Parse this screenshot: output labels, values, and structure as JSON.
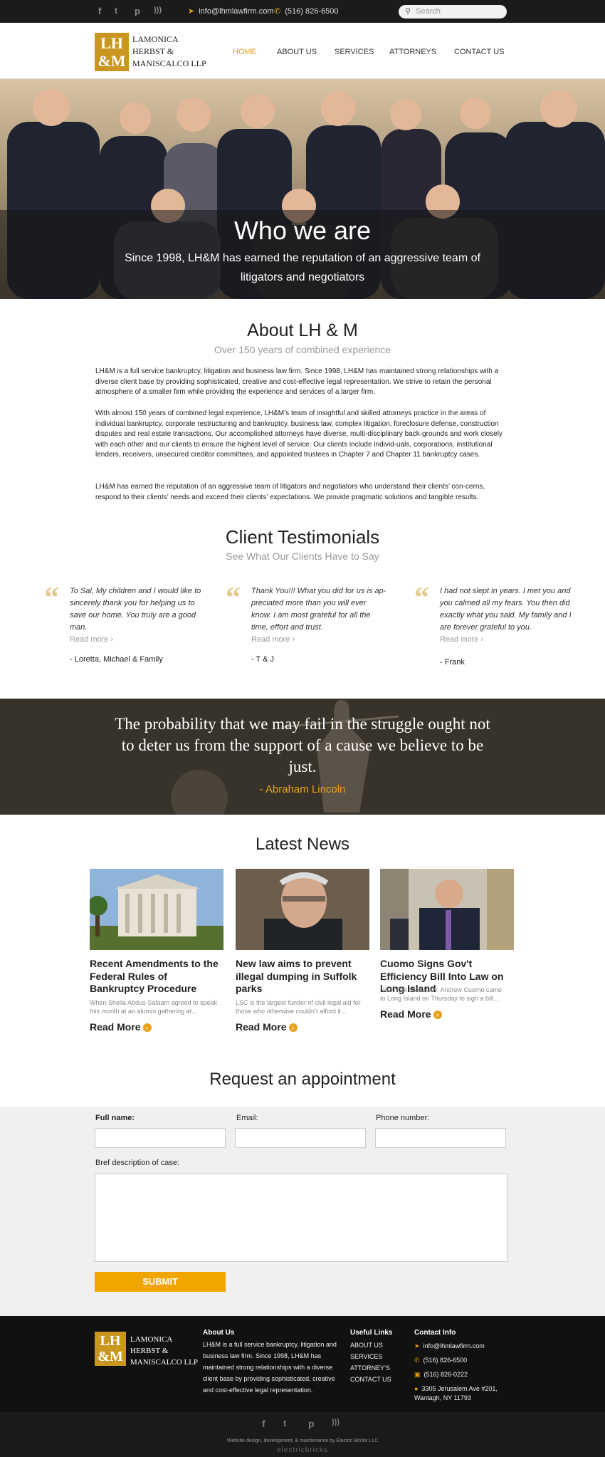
{
  "topbar": {
    "email": "info@lhmlawfirm.com",
    "phone": "(516) 826-6500",
    "search_placeholder": "Search",
    "social": [
      "facebook-icon",
      "twitter-icon",
      "pinterest-icon",
      "rss-icon"
    ]
  },
  "header": {
    "logo_mark": "LH&M",
    "logo_text": "LAMONICA\nHERBST &\nMANISCALCO LLP",
    "nav": [
      "HOME",
      "ABOUT US",
      "SERVICES",
      "ATTORNEYS",
      "CONTACT US"
    ],
    "active_nav": "HOME"
  },
  "hero": {
    "title": "Who we are",
    "subtitle": "Since 1998, LH&M has earned the reputation of an aggressive team of litigators and negotiators"
  },
  "about": {
    "title": "About LH & M",
    "subtitle": "Over 150 years of combined experience",
    "p1": "LH&M is a full service bankruptcy, litigation and business law firm. Since 1998, LH&M has maintained strong relationships with a diverse client base by providing sophisticated, creative and cost-effective legal representation. We strive to retain the personal atmosphere of a smaller firm while providing the experience and services of a larger firm.",
    "p2": "With almost 150 years of combined legal experience, LH&M’s team of insightful and skilled attorneys practice in the areas of individual bankruptcy, corporate restructuring and bankruptcy, business law, complex litigation, foreclosure defense, construction disputes and real estate transactions. Our accomplished attorneys have diverse, multi-disciplinary back-grounds and work closely with each other and our clients to ensure the highest level of service. Our clients include individ-uals, corporations, institutional lenders, receivers, unsecured creditor committees, and appointed trustees in Chapter 7 and Chapter 11 bankruptcy cases.",
    "p3": "LH&M has earned the reputation of an aggressive team of litigators and negotiators who understand their clients’ con-cerns, respond to their clients’ needs and exceed their clients’ expectations. We provide pragmatic solutions and tangible results."
  },
  "testimonials": {
    "title": "Client Testimonials",
    "subtitle": "See What Our Clients Have to Say",
    "read_more": "Read more ›",
    "items": [
      {
        "text": "To Sal, My children and I would like to sincerely thank you for helping us to save our home. You truly are a good man.",
        "author": "- Loretta, Michael & Family"
      },
      {
        "text": "Thank You!!! What you did for us is ap-preciated more than you will ever know. I am most grateful for all the time, effort and trust.",
        "author": "- T & J"
      },
      {
        "text": "I had not slept in years. I met you and you calmed all my fears. You then did exactly what you said. My family and I are forever grateful to you.",
        "author": "- Frank"
      }
    ]
  },
  "quote": {
    "text": "The probability that we may fail in the struggle ought not to deter us from the support of a cause we believe to be just.",
    "author": "- Abraham Lincoln"
  },
  "news": {
    "title": "Latest News",
    "read_more": "Read More",
    "items": [
      {
        "title": "Recent Amendments to the Federal Rules of Bankruptcy Procedure",
        "excerpt": "When Sheila Abdus-Salaam agreed to speak this month at an alumni gathering at..."
      },
      {
        "title": "New law aims to prevent illegal dumping in Suffolk parks",
        "excerpt": "LSC is the largest funder of civil legal aid for those who otherwise couldn’t afford it..."
      },
      {
        "title": "Cuomo Signs Gov't Efficiency Bill Into Law on Long Island",
        "excerpt": "New York State Gov. Andrew Cuomo came to Long Island on Thursday to sign a bill..."
      }
    ]
  },
  "appointment": {
    "title": "Request an appointment",
    "full_name_label": "Full name:",
    "email_label": "Email:",
    "phone_label": "Phone number:",
    "description_label": "Bref description of case:",
    "submit_label": "SUBMIT"
  },
  "footer": {
    "about_title": "About Us",
    "about_text": "LH&M is a full service bankruptcy, litigation and business law firm. Since 1998, LH&M has maintained strong relationships with a diverse client base by providing sophisticated, creative and cost-effective legal representation.",
    "links_title": "Useful Links",
    "links": [
      "ABOUT US",
      "SERVICES",
      "ATTORNEY'S",
      "CONTACT US"
    ],
    "contact_title": "Contact Info",
    "contact_email": "info@lhmlawfirm.com",
    "contact_phone": "(516) 826-6500",
    "contact_fax": "(516) 826-0222",
    "address": "3305 Jerusalem Ave #201,\nWantagh, NY 11793",
    "credit": "Website design, development, & maintenance by Electric Bricks LLC",
    "credit_logo": "electricbricks"
  },
  "colors": {
    "accent": "#e8a21a",
    "submit": "#f0a500",
    "logo_gold": "#c9961f",
    "footer_bg": "#111111"
  }
}
